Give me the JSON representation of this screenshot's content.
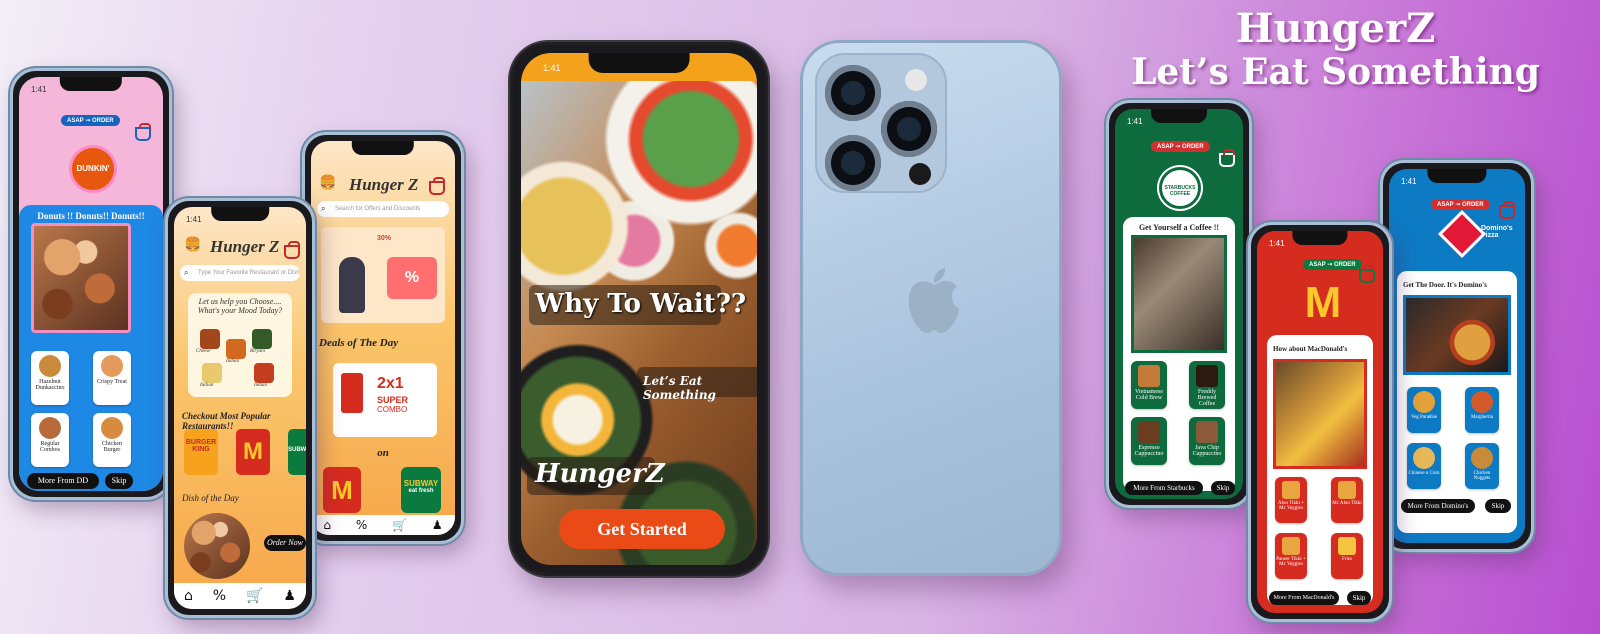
{
  "header": {
    "brand": "HungerZ",
    "tagline": "Let’s Eat Something"
  },
  "pill": {
    "asap": "ASAP",
    "order": "ORDER"
  },
  "dunkin": {
    "status_time": "1:41",
    "logo_text": "DUNKIN'",
    "banner": "Donuts !! Donuts!! Donuts!!",
    "items": [
      "Hazelnut Dunkaccino",
      "Crispy Treat",
      "Regular Combos",
      "Chicken Burger"
    ],
    "more_button": "More From DD",
    "skip_button": "Skip",
    "colors": {
      "bg": "#f4b7d9",
      "panel": "#1e88e5",
      "button": "#111111"
    }
  },
  "home1": {
    "status_time": "1:41",
    "app_title": "Hunger Z",
    "search_placeholder": "Type Your Favorite Restaurant or Dish",
    "help_line1": "Let us help you Choose....",
    "help_line2": "What's your Mood Today?",
    "moods": [
      "Cheese",
      "Indian",
      "Biryani",
      "Italian",
      "Indian"
    ],
    "popular_heading": "Checkout Most Popular Restaurants!!",
    "restaurants": [
      "BURGER KING",
      "McDonald's",
      "SUBWAY"
    ],
    "dish_heading": "Dish of the Day",
    "order_button": "Order Now",
    "colors": {
      "bg": "#fbc66b"
    }
  },
  "home2": {
    "app_title": "Hunger Z",
    "search_placeholder": "Search for Offers and Discounts",
    "offer_text": "30%",
    "deals_heading": "Deals of The Day",
    "promo_line1": "2x1",
    "promo_line2": "SUPER",
    "promo_line3": "COMBO",
    "on_label": "on",
    "brand1": "M",
    "brand2_line1": "SUBWAY",
    "brand2_line2": "eat fresh",
    "colors": {
      "bg": "#fbc66b"
    }
  },
  "splash": {
    "status_time": "1:41",
    "headline": "Why To Wait??",
    "subline": "Let’s Eat Something",
    "brand": "HungerZ",
    "cta": "Get Started",
    "colors": {
      "cta": "#ea4a16",
      "status": "#f4a21b"
    }
  },
  "back_phone": {
    "color": "#b8cfe6",
    "logo": "apple-logo"
  },
  "starbucks": {
    "status_time": "1:41",
    "logo_text": "STARBUCKS COFFEE",
    "heading": "Get Yourself a Coffee !!",
    "items": [
      "Vietnamese Cold Brew",
      "Freshly Brewed Coffee",
      "Espresso Cappuccino",
      "Java Chip Cappuccino"
    ],
    "more_button": "More From Starbucks",
    "skip_button": "Skip",
    "colors": {
      "bg": "#0d6b3e"
    }
  },
  "mcd": {
    "status_time": "1:41",
    "logo_text": "M",
    "heading": "How about MacDonald's",
    "items": [
      "Aloo Tikki + Mc Veggies",
      "Mc Aloo Tikki",
      "Paneer Tikki + Mc Veggies",
      "Fries"
    ],
    "more_button": "More From MacDonald's",
    "skip_button": "Skip",
    "colors": {
      "bg": "#d62b1f",
      "logo": "#ffc72c"
    }
  },
  "dominos": {
    "status_time": "1:41",
    "logo_text": "Domino's Pizza",
    "heading": "Get The Door. It's Domino's",
    "items": [
      "Veg Paradise",
      "Margherita",
      "Chinese n Corn",
      "Chicken Nuggets"
    ],
    "more_button": "More From Domino's",
    "skip_button": "Skip",
    "colors": {
      "bg": "#0d7ac4"
    }
  }
}
